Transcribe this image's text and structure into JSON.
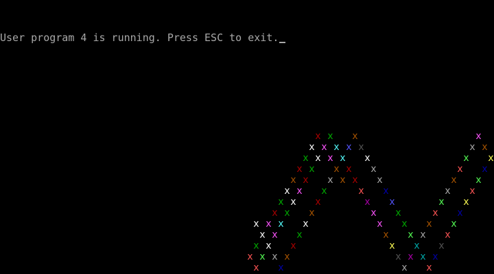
{
  "terminal": {
    "message": "User program 4 is running. Press ESC to exit.",
    "cursor_char": "_",
    "text_color": "#a8a8a8",
    "background": "#000000"
  },
  "pattern": {
    "glyph": "x",
    "palette": [
      "#0000aa",
      "#00aa00",
      "#00aaaa",
      "#aa0000",
      "#aa00aa",
      "#aa5500",
      "#555555",
      "#aaaaaa",
      "#5555ff",
      "#55ff55",
      "#55ffff",
      "#ff5555",
      "#ff55ff",
      "#ffff55",
      "#ffffff"
    ]
  }
}
